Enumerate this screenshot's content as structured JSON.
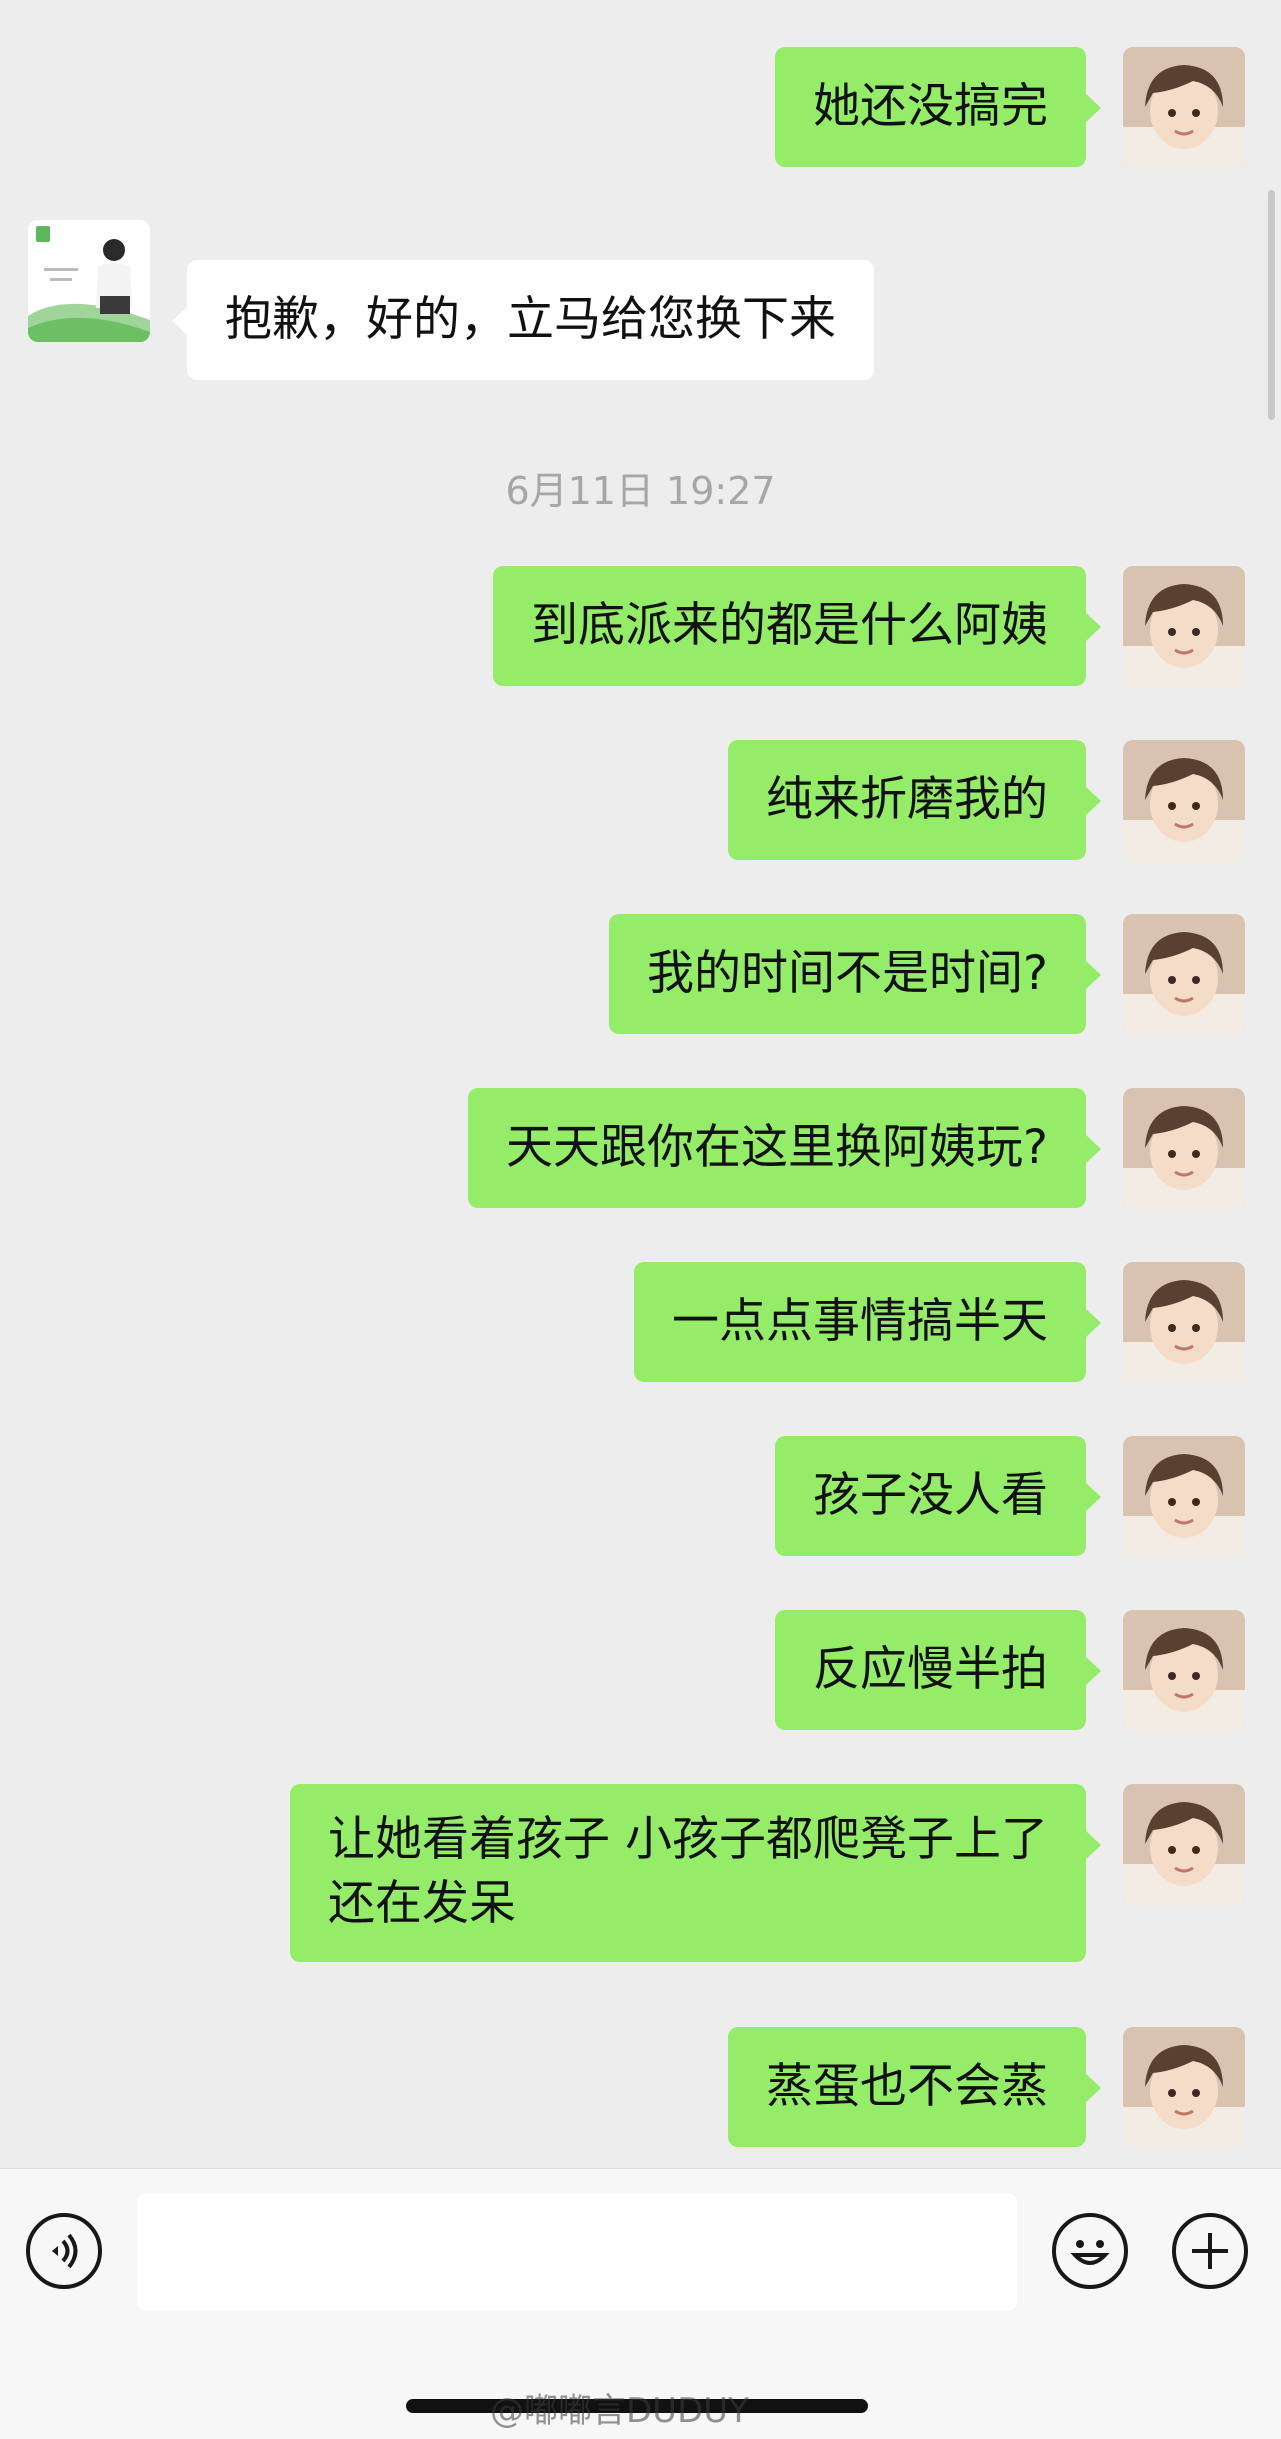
{
  "conversation": {
    "timestamp": "6月11日 19:27",
    "messages": [
      {
        "id": "m1",
        "from": "me",
        "lines": [
          "她还没搞完"
        ]
      },
      {
        "id": "m2",
        "from": "other",
        "lines": [
          "抱歉，好的，立马给您换下来"
        ]
      },
      {
        "id": "m3",
        "from": "me",
        "lines": [
          "到底派来的都是什么阿姨"
        ]
      },
      {
        "id": "m4",
        "from": "me",
        "lines": [
          "纯来折磨我的"
        ]
      },
      {
        "id": "m5",
        "from": "me",
        "lines": [
          "我的时间不是时间?"
        ]
      },
      {
        "id": "m6",
        "from": "me",
        "lines": [
          "天天跟你在这里换阿姨玩?"
        ]
      },
      {
        "id": "m7",
        "from": "me",
        "lines": [
          "一点点事情搞半天"
        ]
      },
      {
        "id": "m8",
        "from": "me",
        "lines": [
          "孩子没人看"
        ]
      },
      {
        "id": "m9",
        "from": "me",
        "lines": [
          "反应慢半拍"
        ]
      },
      {
        "id": "m10",
        "from": "me",
        "lines": [
          "让她看着孩子 小孩子都爬凳子上了",
          "还在发呆"
        ]
      },
      {
        "id": "m11",
        "from": "me",
        "lines": [
          "蒸蛋也不会蒸"
        ]
      }
    ]
  },
  "input_bar": {
    "input_value": "",
    "icons": [
      "voice-icon",
      "emoji-icon",
      "plus-icon"
    ]
  },
  "watermark": "@嘟嘟言DUDUY",
  "colors": {
    "chat_background": "#ededed",
    "my_bubble": "#95ec69",
    "other_bubble": "#ffffff",
    "timestamp_text": "#a6a6a6"
  }
}
